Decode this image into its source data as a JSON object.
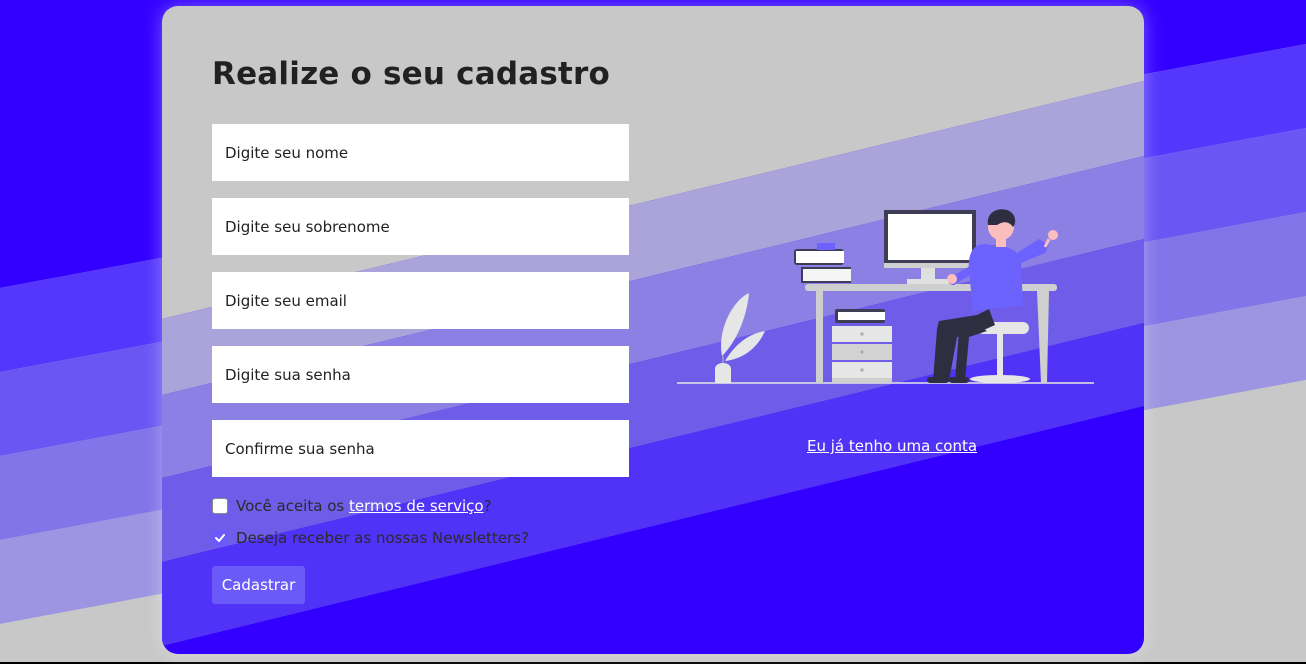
{
  "colors": {
    "primary": "#3300ff",
    "button": "#6a5af9",
    "card_gray": "#c8c8c8",
    "title": "#212121"
  },
  "form": {
    "title": "Realize o seu cadastro",
    "fields": [
      {
        "placeholder": "Digite seu nome",
        "value": ""
      },
      {
        "placeholder": "Digite seu sobrenome",
        "value": ""
      },
      {
        "placeholder": "Digite seu email",
        "value": ""
      },
      {
        "placeholder": "Digite sua senha",
        "value": ""
      },
      {
        "placeholder": "Confirme sua senha",
        "value": ""
      }
    ],
    "terms": {
      "checked": false,
      "prefix": "Você aceita os ",
      "link": "termos de serviço",
      "suffix": "?"
    },
    "newsletter": {
      "checked": true,
      "label": "Deseja receber as nossas Newsletters?"
    },
    "submit_label": "Cadastrar"
  },
  "side": {
    "illustration": "person-at-desk-illustration",
    "login_link": "Eu já tenho uma conta"
  }
}
